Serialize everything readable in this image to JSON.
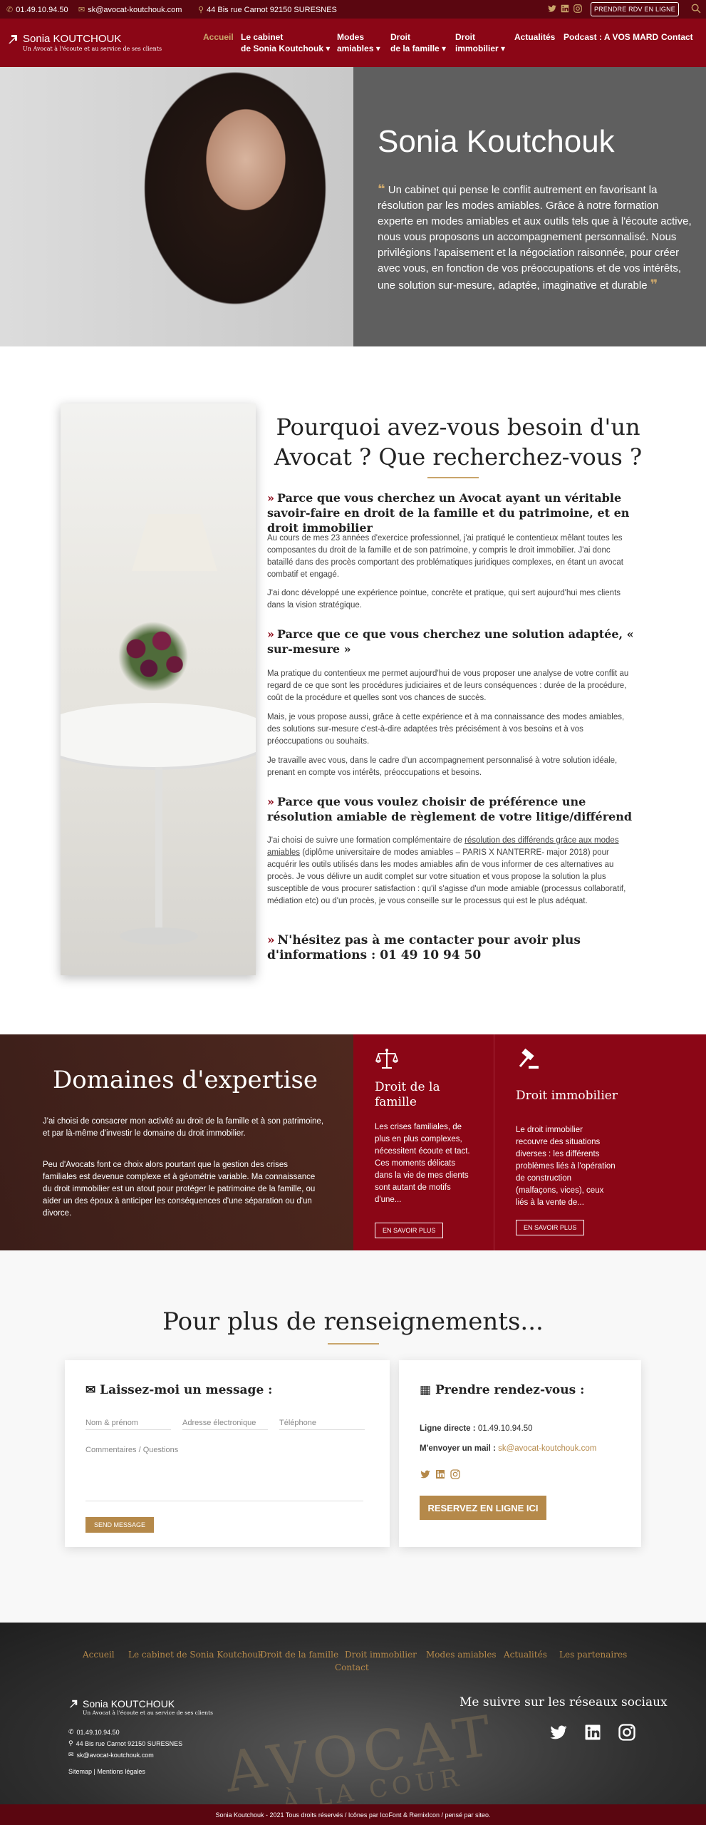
{
  "topbar": {
    "phone": "01.49.10.94.50",
    "email": "sk@avocat-koutchouk.com",
    "address": "44 Bis rue Carnot 92150 SURESNES",
    "rdv_button": "PRENDRE RDV EN LIGNE",
    "social_icons": [
      "twitter-icon",
      "linkedin-icon",
      "instagram-icon"
    ]
  },
  "nav": {
    "logo_name": "Sonia KOUTCHOUK",
    "logo_tagline": "Un Avocat à l'écoute et au service de ses clients",
    "items": [
      {
        "label": "Accueil",
        "active": true
      },
      {
        "label": "Le cabinet",
        "label2": "de Sonia Koutchouk ▾"
      },
      {
        "label": "Modes",
        "label2": "amiables ▾"
      },
      {
        "label": "Droit",
        "label2": "de la famille ▾"
      },
      {
        "label": "Droit",
        "label2": "immobilier ▾"
      },
      {
        "label": "Actualités"
      },
      {
        "label": "Podcast : A VOS MARD"
      },
      {
        "label": "Contact"
      }
    ]
  },
  "hero": {
    "title": "Sonia Koutchouk",
    "quote_open": "❝",
    "quote": "Un cabinet qui pense le conflit autrement en favorisant la résolution par les modes amiables. Grâce à notre formation experte en modes amiables et aux outils tels que à l'écoute active, nous vous proposons un accompagnement personnalisé. Nous privilégions l'apaisement et la négociation raisonnée, pour créer avec vous, en fonction de vos préoccupations et de vos intérêts, une solution sur-mesure, adaptée, imaginative et durable",
    "quote_close": "❞"
  },
  "why": {
    "title": "Pourquoi avez-vous besoin d'un Avocat ? Que recherchez-vous ?",
    "arrow": "»",
    "h1": "Parce que vous cherchez un Avocat ayant un véritable savoir-faire en droit de la famille et du patrimoine, et en droit immobilier",
    "p1": "Au cours de mes 23 années d'exercice professionnel, j'ai pratiqué le contentieux mêlant toutes les composantes du droit de la famille et de son patrimoine, y compris le droit immobilier. J'ai donc bataillé dans des procès comportant des problématiques juridiques complexes, en étant un avocat combatif et engagé.",
    "p2": "J'ai donc développé une expérience pointue, concrète et pratique, qui sert aujourd'hui mes clients dans la vision stratégique.",
    "h2": "Parce que ce que vous cherchez une solution adaptée, « sur-mesure »",
    "p3": "Ma pratique du contentieux me permet aujourd'hui de vous proposer une analyse de votre conflit au regard de ce que sont les procédures judiciaires et de leurs conséquences : durée de la procédure, coût de la procédure et quelles sont vos chances de succès.",
    "p4": "Mais, je vous propose aussi, grâce à cette expérience et à ma connaissance des modes amiables, des solutions sur-mesure c'est-à-dire adaptées très précisément à vos besoins et à vos préoccupations ou souhaits.",
    "p5": "Je travaille avec vous, dans le cadre d'un accompagnement personnalisé à votre solution idéale, prenant en compte vos intérêts, préoccupations et besoins.",
    "h3": "Parce que vous voulez choisir de préférence une résolution amiable de règlement de votre litige/différend",
    "p6a": "J'ai choisi de suivre une formation complémentaire de ",
    "p6link": "résolution des différends grâce aux modes amiables",
    "p6b": " (diplôme universitaire de modes amiables – PARIS X NANTERRE- major 2018) pour acquérir les outils utilisés dans les modes amiables afin de vous informer de ces alternatives au procès. Je vous délivre un audit complet sur votre situation et vous propose la solution la plus susceptible de vous procurer satisfaction : qu'il s'agisse d'un mode amiable (processus collaboratif, médiation etc) ou d'un procès, je vous conseille sur le processus qui est le plus adéquat.",
    "h4": "N'hésitez pas à me contacter pour avoir plus d'informations : 01 49 10 94 50"
  },
  "domains": {
    "title": "Domaines d'expertise",
    "p1": "J'ai choisi de consacrer mon activité au droit de la famille et à son patrimoine, et par là-même d'investir le domaine du droit immobilier.",
    "p2": "Peu d'Avocats font ce choix alors pourtant que la gestion des crises familiales est devenue complexe et à géométrie variable. Ma connaissance du droit immobilier est un atout pour protéger le patrimoine de la famille, ou aider un des époux à anticiper les conséquences d'une séparation ou d'un divorce.",
    "cards": [
      {
        "icon": "scales-icon",
        "title": "Droit de la famille",
        "text": "Les crises familiales, de plus en plus complexes, nécessitent écoute et tact. Ces moments délicats dans la vie de mes clients sont autant de motifs d'une...",
        "button": "EN SAVOIR PLUS"
      },
      {
        "icon": "gavel-icon",
        "title": "Droit immobilier",
        "text": "Le droit immobilier recouvre des situations diverses : les différents problèmes liés à l'opération de construction (malfaçons, vices), ceux liés à la vente de...",
        "button": "EN SAVOIR PLUS"
      }
    ]
  },
  "contact": {
    "title": "Pour plus de renseignements...",
    "message_title": "✉ Laissez-moi un message :",
    "name_placeholder": "Nom & prénom",
    "email_placeholder": "Adresse électronique",
    "phone_placeholder": "Téléphone",
    "comments_placeholder": "Commentaires / Questions",
    "send": "SEND MESSAGE",
    "rdv_title": "▦ Prendre rendez-vous :",
    "direct_label": "Ligne directe :",
    "direct_value": "01.49.10.94.50",
    "mail_label": "M'envoyer un mail :",
    "mail_value": "sk@avocat-koutchouk.com",
    "book_button": "RESERVEZ EN LIGNE ICI"
  },
  "footer": {
    "links": [
      "Accueil",
      "Le cabinet de Sonia Koutchouk",
      "Droit de la famille",
      "Droit immobilier",
      "Modes amiables",
      "Actualités",
      "Les partenaires",
      "Contact"
    ],
    "logo_name": "Sonia KOUTCHOUK",
    "logo_tagline": "Un Avocat à l'écoute et au service de ses clients",
    "phone": "01.49.10.94.50",
    "address": "44 Bis rue Carnot 92150 SURESNES",
    "email": "sk@avocat-koutchouk.com",
    "legal": "Sitemap | Mentions légales",
    "follow": "Me suivre sur les réseaux sociaux",
    "watermark1": "AVOCAT",
    "watermark2": "À LA COUR",
    "copyright": "Sonia Koutchouk - 2021 Tous droits réservés / Icônes par IcoFont & RemixIcon / pensé par siteo."
  }
}
